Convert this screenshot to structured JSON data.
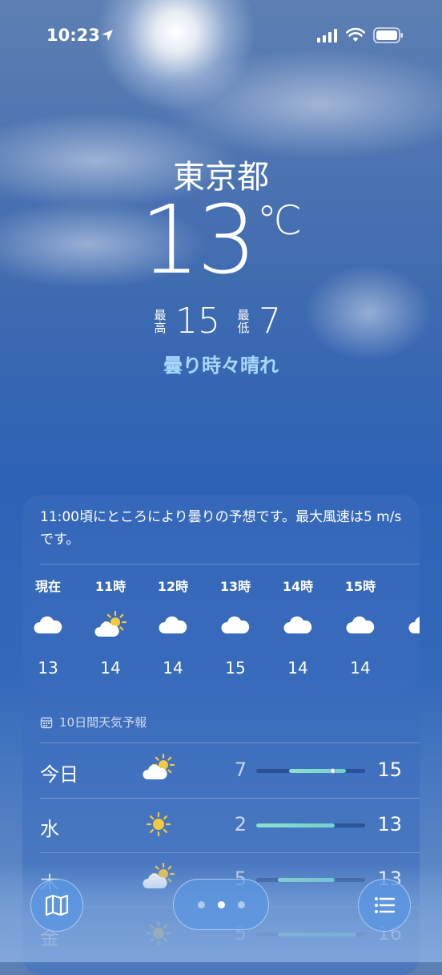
{
  "status": {
    "time": "10:23"
  },
  "hero": {
    "city": "東京都",
    "temp": "13",
    "unit": "℃",
    "high_label_top": "最",
    "high_label_bottom": "高",
    "high": "15",
    "low_label_top": "最",
    "low_label_bottom": "低",
    "low": "7",
    "condition": "曇り時々晴れ"
  },
  "hourly": {
    "summary": "11:00頃にところにより曇りの予想です。最大風速は5 m/sです。",
    "hours": [
      {
        "label": "現在",
        "icon": "cloud-icon",
        "temp": "13"
      },
      {
        "label": "11時",
        "icon": "partly-sunny-icon",
        "temp": "14"
      },
      {
        "label": "12時",
        "icon": "cloud-icon",
        "temp": "14"
      },
      {
        "label": "13時",
        "icon": "cloud-icon",
        "temp": "15"
      },
      {
        "label": "14時",
        "icon": "cloud-icon",
        "temp": "14"
      },
      {
        "label": "15時",
        "icon": "cloud-icon",
        "temp": "14"
      },
      {
        "label": "1",
        "icon": "cloud-icon",
        "temp": ""
      }
    ]
  },
  "forecast": {
    "header": "10日間天気予報",
    "days": [
      {
        "name": "今日",
        "icon": "partly-sunny-icon",
        "low": "7",
        "high": "15",
        "fill_start": 0.3,
        "fill_end": 0.82,
        "current": 0.7
      },
      {
        "name": "水",
        "icon": "sun-icon",
        "low": "2",
        "high": "13",
        "fill_start": 0.0,
        "fill_end": 0.72
      },
      {
        "name": "木",
        "icon": "partly-sunny-icon",
        "low": "5",
        "high": "13",
        "fill_start": 0.2,
        "fill_end": 0.72
      },
      {
        "name": "金",
        "icon": "sun-icon",
        "low": "5",
        "high": "16",
        "fill_start": 0.2,
        "fill_end": 0.92
      }
    ]
  },
  "colors": {
    "accent_condition": "#a8d8ff",
    "bar_fill": "#7fdac9"
  }
}
